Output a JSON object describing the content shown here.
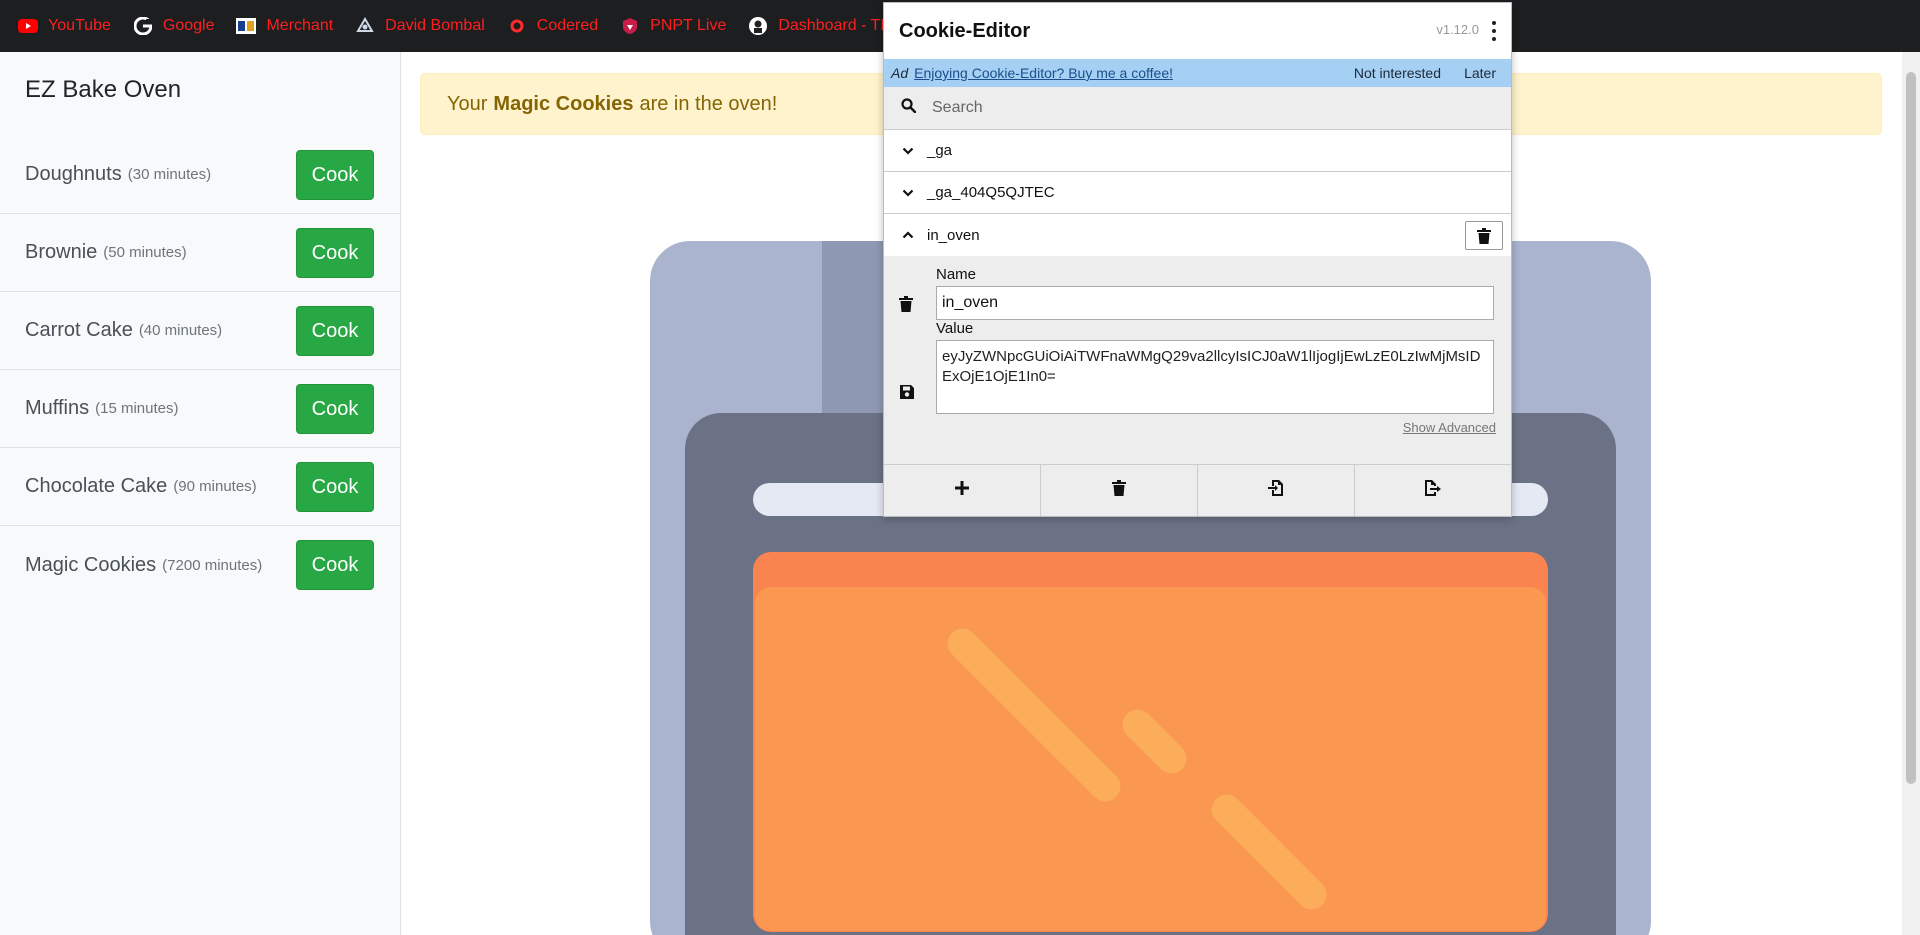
{
  "bookmarks": [
    {
      "label": "YouTube",
      "icon": "youtube-icon"
    },
    {
      "label": "Google",
      "icon": "google-icon"
    },
    {
      "label": "Merchant",
      "icon": "merchant-icon"
    },
    {
      "label": "David Bombal",
      "icon": "david-bombal-icon"
    },
    {
      "label": "Codered",
      "icon": "codered-icon"
    },
    {
      "label": "PNPT Live",
      "icon": "pnpt-icon"
    },
    {
      "label": "Dashboard - TMG S...",
      "icon": "dashboard-icon"
    }
  ],
  "sidebar": {
    "title": "EZ Bake Oven",
    "recipes": [
      {
        "name": "Doughnuts",
        "duration": "(30 minutes)",
        "button": "Cook"
      },
      {
        "name": "Brownie",
        "duration": "(50 minutes)",
        "button": "Cook"
      },
      {
        "name": "Carrot Cake",
        "duration": "(40 minutes)",
        "button": "Cook"
      },
      {
        "name": "Muffins",
        "duration": "(15 minutes)",
        "button": "Cook"
      },
      {
        "name": "Chocolate Cake",
        "duration": "(90 minutes)",
        "button": "Cook"
      },
      {
        "name": "Magic Cookies",
        "duration": "(7200 minutes)",
        "button": "Cook"
      }
    ]
  },
  "alert": {
    "prefix": "Your",
    "highlight": "Magic Cookies",
    "suffix": "are in the oven!"
  },
  "cookie_editor": {
    "title": "Cookie-Editor",
    "version": "v1.12.0",
    "ad": {
      "tag": "Ad",
      "link": "Enjoying Cookie-Editor? Buy me a coffee!",
      "not_interested": "Not interested",
      "later": "Later"
    },
    "search_placeholder": "Search",
    "cookies": [
      "_ga",
      "_ga_404Q5QJTEC",
      "in_oven"
    ],
    "expanded": {
      "name_label": "Name",
      "name_value": "in_oven",
      "value_label": "Value",
      "value": "eyJyZWNpcGUiOiAiTWFnaWMgQ29va2llcyIsICJ0aW1lIjogIjEwLzE0LzIwMjMsIDExOjE1OjE1In0=",
      "show_advanced": "Show Advanced"
    }
  },
  "colors": {
    "bookmark_text": "#ff1e1e",
    "cook_button": "#28a745",
    "alert_bg": "#fff3cd",
    "ad_bg": "#a6cff4",
    "oven_window": "#fa8450"
  }
}
